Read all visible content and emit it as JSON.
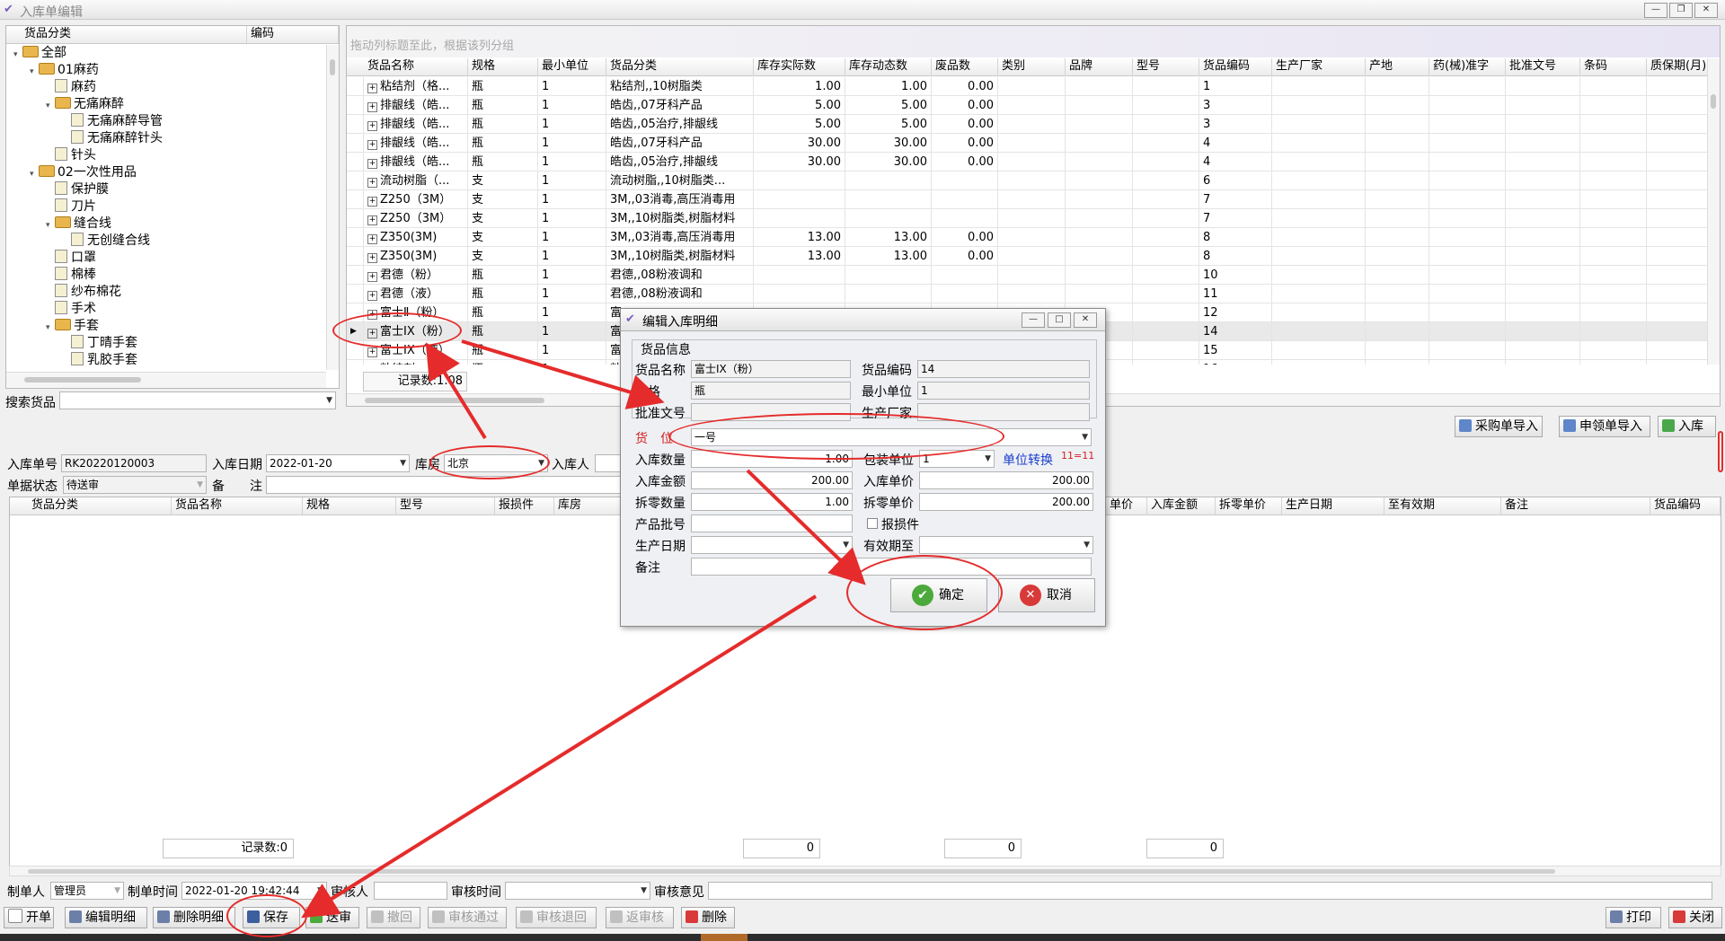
{
  "window": {
    "title": "入库单编辑"
  },
  "tree": {
    "headers": [
      "货品分类",
      "编码"
    ],
    "nodes": [
      {
        "label": "全部",
        "level": 0,
        "type": "folder",
        "exp": "▾"
      },
      {
        "label": "01麻药",
        "level": 1,
        "type": "folder",
        "exp": "▾"
      },
      {
        "label": "麻药",
        "level": 2,
        "type": "doc",
        "exp": ""
      },
      {
        "label": "无痛麻醉",
        "level": 2,
        "type": "folder",
        "exp": "▾"
      },
      {
        "label": "无痛麻醉导管",
        "level": 3,
        "type": "doc",
        "exp": ""
      },
      {
        "label": "无痛麻醉针头",
        "level": 3,
        "type": "doc",
        "exp": ""
      },
      {
        "label": "针头",
        "level": 2,
        "type": "doc",
        "exp": ""
      },
      {
        "label": "02一次性用品",
        "level": 1,
        "type": "folder",
        "exp": "▾"
      },
      {
        "label": "保护膜",
        "level": 2,
        "type": "doc",
        "exp": ""
      },
      {
        "label": "刀片",
        "level": 2,
        "type": "doc",
        "exp": ""
      },
      {
        "label": "缝合线",
        "level": 2,
        "type": "folder",
        "exp": "▾"
      },
      {
        "label": "无创缝合线",
        "level": 3,
        "type": "doc",
        "exp": ""
      },
      {
        "label": "口罩",
        "level": 2,
        "type": "doc",
        "exp": ""
      },
      {
        "label": "棉棒",
        "level": 2,
        "type": "doc",
        "exp": ""
      },
      {
        "label": "纱布棉花",
        "level": 2,
        "type": "doc",
        "exp": ""
      },
      {
        "label": "手术",
        "level": 2,
        "type": "doc",
        "exp": ""
      },
      {
        "label": "手套",
        "level": 2,
        "type": "folder",
        "exp": "▾"
      },
      {
        "label": "丁晴手套",
        "level": 3,
        "type": "doc",
        "exp": ""
      },
      {
        "label": "乳胶手套",
        "level": 3,
        "type": "doc",
        "exp": ""
      }
    ]
  },
  "search": {
    "label": "搜索货品"
  },
  "goods": {
    "group_hint": "拖动列标题至此，根据该列分组",
    "headers": [
      "货品名称",
      "规格",
      "最小单位",
      "货品分类",
      "库存实际数",
      "库存动态数",
      "废品数",
      "类别",
      "品牌",
      "型号",
      "货品编码",
      "生产厂家",
      "产地",
      "药(械)准字",
      "批准文号",
      "条码",
      "质保期(月)"
    ],
    "rows": [
      [
        "粘结剂（格...",
        "瓶",
        "1",
        "粘结剂,,10树脂类",
        "1.00",
        "1.00",
        "0.00",
        "1"
      ],
      [
        "排龈线（皓...",
        "瓶",
        "1",
        "皓齿,,07牙科产品",
        "5.00",
        "5.00",
        "0.00",
        "3"
      ],
      [
        "排龈线（皓...",
        "瓶",
        "1",
        "皓齿,,05治疗,排龈线",
        "5.00",
        "5.00",
        "0.00",
        "3"
      ],
      [
        "排龈线（皓...",
        "瓶",
        "1",
        "皓齿,,07牙科产品",
        "30.00",
        "30.00",
        "0.00",
        "4"
      ],
      [
        "排龈线（皓...",
        "瓶",
        "1",
        "皓齿,,05治疗,排龈线",
        "30.00",
        "30.00",
        "0.00",
        "4"
      ],
      [
        "流动树脂（...",
        "支",
        "1",
        "流动树脂,,10树脂类...",
        "",
        "",
        "",
        "6"
      ],
      [
        "Z250（3M）",
        "支",
        "1",
        "3M,,03消毒,高压消毒用",
        "",
        "",
        "",
        "7"
      ],
      [
        "Z250（3M）",
        "支",
        "1",
        "3M,,10树脂类,树脂材料",
        "",
        "",
        "",
        "7"
      ],
      [
        "Z350(3M)",
        "支",
        "1",
        "3M,,03消毒,高压消毒用",
        "13.00",
        "13.00",
        "0.00",
        "8"
      ],
      [
        "Z350(3M)",
        "支",
        "1",
        "3M,,10树脂类,树脂材料",
        "13.00",
        "13.00",
        "0.00",
        "8"
      ],
      [
        "君德（粉）",
        "瓶",
        "1",
        "君德,,08粉液调和",
        "",
        "",
        "",
        "10"
      ],
      [
        "君德（液）",
        "瓶",
        "1",
        "君德,,08粉液调和",
        "",
        "",
        "",
        "11"
      ],
      [
        "富士Ⅱ（粉）",
        "瓶",
        "1",
        "富",
        "",
        "",
        "",
        "12"
      ],
      [
        "富士IX（粉）",
        "瓶",
        "1",
        "富",
        "",
        "",
        "",
        "14"
      ],
      [
        "富士IX（液）",
        "瓶",
        "1",
        "富",
        "",
        "",
        "",
        "15"
      ],
      [
        "粘结剂",
        "瓶",
        "1",
        "粘",
        "",
        "",
        "",
        "16"
      ]
    ],
    "record_count": "记录数:1.08"
  },
  "import_buttons": [
    "采购单导入",
    "申领单导入",
    "入库"
  ],
  "order": {
    "no_label": "入库单号",
    "no_value": "RK20220120003",
    "date_label": "入库日期",
    "date_value": "2022-01-20",
    "store_label": "库房",
    "store_value": "北京",
    "person_label": "入库人",
    "status_label": "单据状态",
    "status_value": "待送审",
    "remark_label": "备　　注"
  },
  "detail": {
    "headers_left": [
      "货品分类",
      "货品名称",
      "规格",
      "型号",
      "报损件",
      "库房",
      "货"
    ],
    "headers_right": [
      "单价",
      "入库金额",
      "拆零单价",
      "生产日期",
      "至有效期",
      "备注",
      "货品编码"
    ],
    "record_count": "记录数:0",
    "sums": [
      "0",
      "0",
      "0"
    ]
  },
  "footer": {
    "maker_label": "制单人",
    "maker_value": "管理员",
    "time_label": "制单时间",
    "time_value": "2022-01-20 19:42:44",
    "auditor_label": "审核人",
    "audit_time_label": "审核时间",
    "audit_opinion_label": "审核意见"
  },
  "toolbar": [
    "开单",
    "编辑明细",
    "删除明细",
    "保存",
    "送审",
    "撤回",
    "审核通过",
    "审核退回",
    "返审核",
    "删除"
  ],
  "toolbar_right": [
    "打印",
    "关闭"
  ],
  "dialog": {
    "title": "编辑入库明细",
    "group": "货品信息",
    "name_label": "货品名称",
    "name_value": "富士IX（粉）",
    "code_label": "货品编码",
    "code_value": "14",
    "spec_label": "规格",
    "spec_value": "瓶",
    "unit_label": "最小单位",
    "unit_value": "1",
    "approval_label": "批准文号",
    "maker_label": "生产厂家",
    "location_label": "货　位",
    "location_value": "一号",
    "qty_label": "入库数量",
    "qty_value": "1.00",
    "pack_label": "包装单位",
    "pack_value": "1",
    "convert_label": "单位转换",
    "convert_ratio": "11=11",
    "amount_label": "入库金额",
    "amount_value": "200.00",
    "price_label": "入库单价",
    "price_value": "200.00",
    "split_qty_label": "拆零数量",
    "split_qty_value": "1.00",
    "split_price_label": "拆零单价",
    "split_price_value": "200.00",
    "batch_label": "产品批号",
    "damage_label": "报损件",
    "prod_date_label": "生产日期",
    "expiry_label": "有效期至",
    "remark_label": "备注",
    "ok": "确定",
    "cancel": "取消"
  }
}
